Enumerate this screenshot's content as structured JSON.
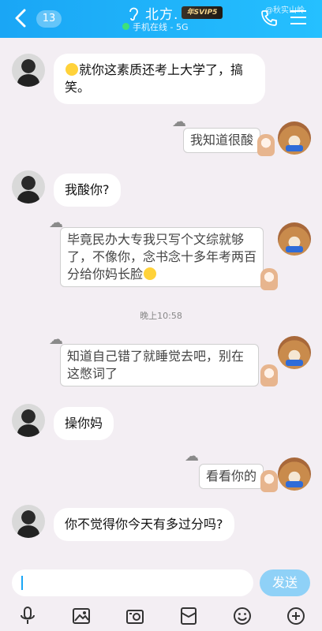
{
  "header": {
    "unread_count": "13",
    "contact_name": "北方.",
    "vip_label": "年SVIP5",
    "status": "手机在线 - 5G",
    "watermark": "@秋实山岭"
  },
  "messages": [
    {
      "side": "left",
      "text": "就你这素质还考上大学了，搞笑。"
    },
    {
      "side": "right",
      "text": "我知道很酸"
    },
    {
      "side": "left",
      "text": "我酸你?"
    },
    {
      "side": "right",
      "text": "毕竟民办大专我只写个文综就够了，不像你，念书念十多年考两百分给你妈长脸"
    },
    {
      "side": "time",
      "text": "晚上10:58"
    },
    {
      "side": "right",
      "text": "知道自己错了就睡觉去吧，别在这憋词了"
    },
    {
      "side": "left",
      "text": "操你妈"
    },
    {
      "side": "right",
      "text": "看看你的"
    },
    {
      "side": "left",
      "text": "你不觉得你今天有多过分吗?"
    }
  ],
  "input": {
    "value": "",
    "send_label": "发送"
  },
  "toolbar": [
    "mic-icon",
    "image-icon",
    "camera-icon",
    "red-packet-icon",
    "emoji-icon",
    "plus-icon"
  ],
  "colors": {
    "header": "#1aa6f5",
    "background": "#f3eef3",
    "send_button": "#8fd1f7"
  }
}
